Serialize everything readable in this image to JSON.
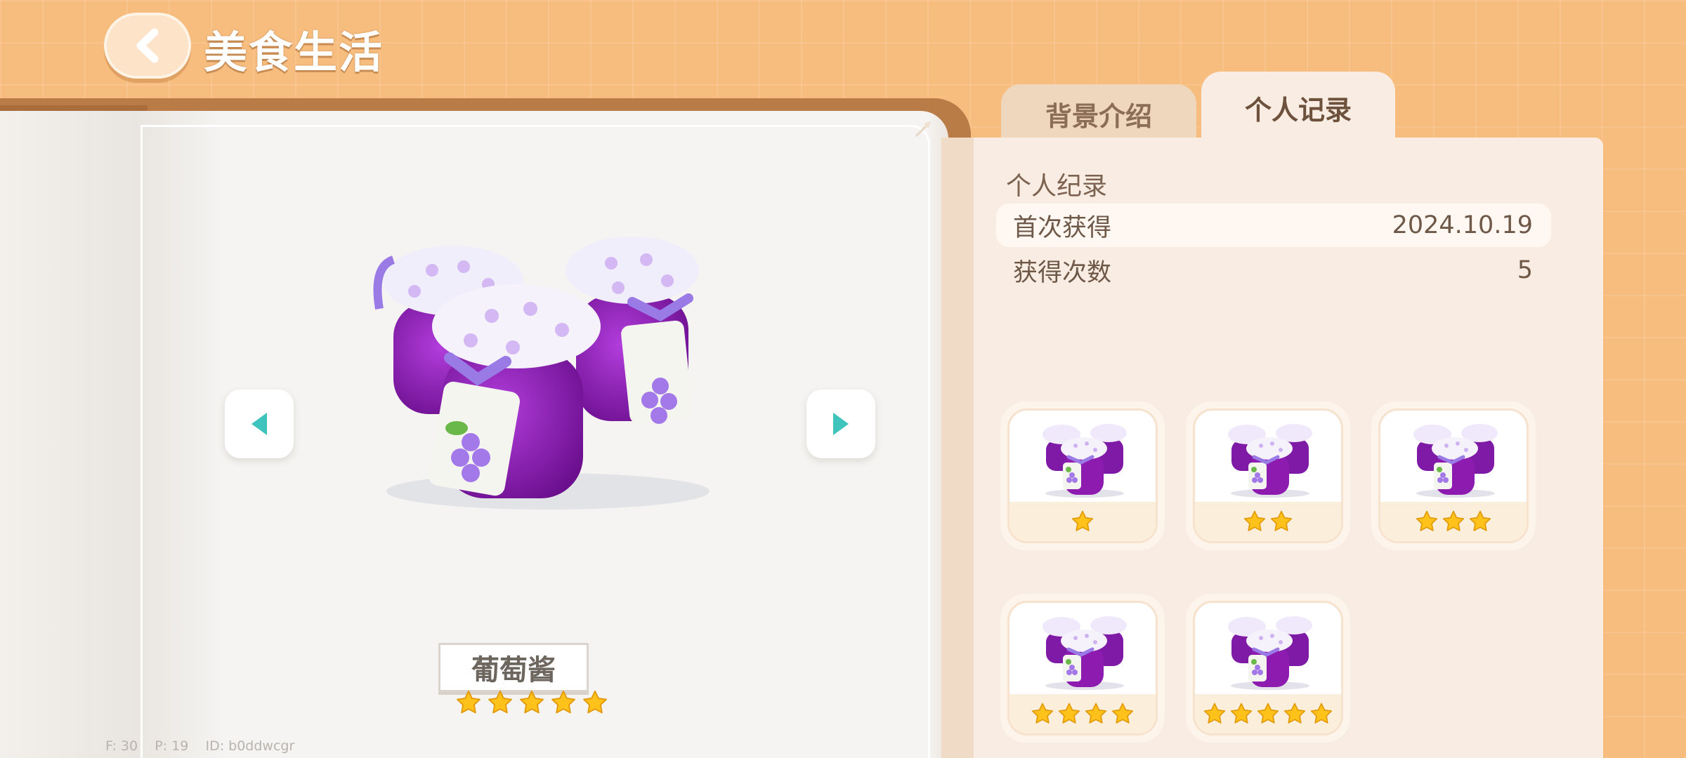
{
  "header": {
    "title": "美食生活",
    "back_icon": "chevron-left-icon"
  },
  "item": {
    "name": "葡萄酱",
    "stars": 5
  },
  "tabs": [
    {
      "label": "背景介绍",
      "active": false
    },
    {
      "label": "个人记录",
      "active": true
    }
  ],
  "record": {
    "section_title": "个人纪录",
    "first_obtained_label": "首次获得",
    "first_obtained_value": "2024.10.19",
    "count_label": "获得次数",
    "count_value": "5"
  },
  "variants": [
    {
      "stars": 1
    },
    {
      "stars": 2
    },
    {
      "stars": 3
    },
    {
      "stars": 4
    },
    {
      "stars": 5
    }
  ],
  "debug": {
    "text": "F: 30    P: 19    ID: b0ddwcgr"
  },
  "colors": {
    "accent_teal": "#3fc3bd",
    "star": "#ffc21a",
    "background": "#f7bd7e",
    "jam_purple": "#8d1bb0"
  }
}
